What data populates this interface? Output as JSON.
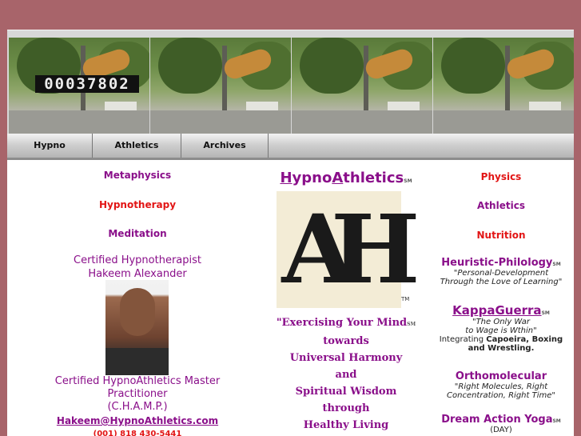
{
  "counter": "00037802",
  "nav": [
    {
      "label": "Hypno"
    },
    {
      "label": "Athletics"
    },
    {
      "label": "Archives"
    }
  ],
  "left": {
    "links": [
      "Metaphysics",
      "Hypnotherapy",
      "Meditation"
    ],
    "title1": "Certified Hypnotherapist",
    "title2": "Hakeem Alexander",
    "role1": "Certified HypnoAthletics Master",
    "role2": "Practitioner",
    "acronym": "(C.H.A.M.P.)",
    "email": "Hakeem@HypnoAthletics.com",
    "phone": "(001) 818 430-5441"
  },
  "center": {
    "brand_hypno_first": "H",
    "brand_hypno_rest": "ypno",
    "brand_ath_first": "A",
    "brand_ath_rest": "thletics",
    "sm": "SM",
    "logo_letters": "AH",
    "tm": "TM",
    "quote_open": "\"Exercising Your Mind",
    "lines": [
      "towards",
      "Universal Harmony",
      "and",
      "Spiritual Wisdom",
      "through",
      "Healthy Living"
    ]
  },
  "right": {
    "links": [
      "Physics",
      "Athletics",
      "Nutrition"
    ],
    "heuristic": "Heuristic-Philology",
    "heuristic_sub1": "\"Personal-Development",
    "heuristic_sub2": "Through the Love of Learning\"",
    "kappa": "KappaGuerra",
    "kappa_sub1": "\"The Only War",
    "kappa_sub2": "to Wage is Wthin\"",
    "kappa_sub3_pre": "Integrating ",
    "kappa_sub3_bold": "Capoeira, Boxing",
    "kappa_sub4": "and Wrestling.",
    "ortho": "Orthomolecular",
    "ortho_sub1": "\"Right Molecules, Right",
    "ortho_sub2": "Concentration, Right Time\"",
    "yoga": "Dream Action Yoga",
    "yoga_sub": "(DAY)"
  }
}
